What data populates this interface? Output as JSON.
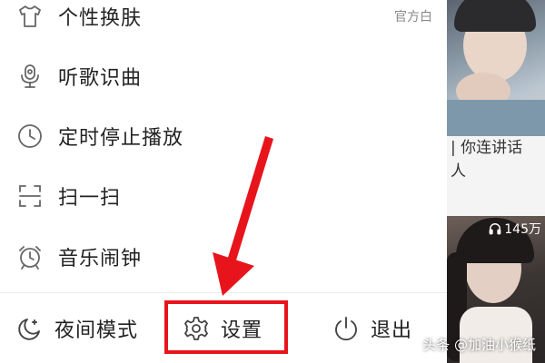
{
  "menu": {
    "items": [
      {
        "label": "个性换肤",
        "value": "官方白",
        "icon": "tshirt-icon"
      },
      {
        "label": "听歌识曲",
        "value": "",
        "icon": "music-recognition-icon"
      },
      {
        "label": "定时停止播放",
        "value": "",
        "icon": "clock-icon"
      },
      {
        "label": "扫一扫",
        "value": "",
        "icon": "scan-icon"
      },
      {
        "label": "音乐闹钟",
        "value": "",
        "icon": "alarm-clock-icon"
      }
    ]
  },
  "bottom_bar": {
    "night_mode_label": "夜间模式",
    "settings_label": "设置",
    "exit_label": "退出"
  },
  "feed": {
    "text_line1": "| 你连讲话",
    "text_line2": "人",
    "play_count": "145万"
  },
  "watermark": "头条 @加油小猴纸",
  "colors": {
    "annotation_red": "#e8141b"
  }
}
